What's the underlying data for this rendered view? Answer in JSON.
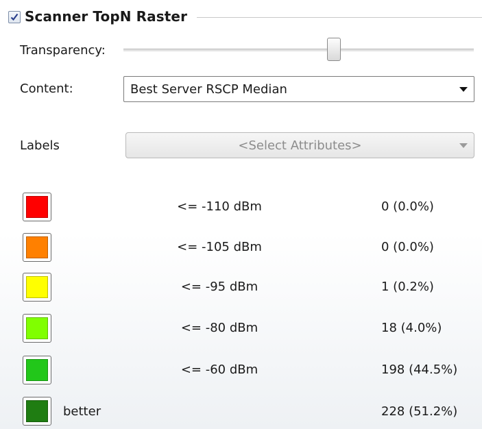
{
  "group": {
    "title": "Scanner TopN Raster",
    "enabled": true
  },
  "transparency": {
    "label": "Transparency:",
    "value": 0.6
  },
  "content": {
    "label": "Content:",
    "value": "Best Server RSCP Median"
  },
  "labels": {
    "label": "Labels",
    "placeholder": "<Select Attributes>",
    "enabled": false
  },
  "legend": [
    {
      "color": "#ff0000",
      "threshold": "<= -110 dBm",
      "count": "0 (0.0%)"
    },
    {
      "color": "#ff8000",
      "threshold": "<= -105 dBm",
      "count": "0 (0.0%)"
    },
    {
      "color": "#ffff00",
      "threshold": "<= -95 dBm",
      "count": "1 (0.2%)"
    },
    {
      "color": "#80ff00",
      "threshold": "<= -80 dBm",
      "count": "18 (4.0%)"
    },
    {
      "color": "#22c71a",
      "threshold": "<= -60 dBm",
      "count": "198 (44.5%)"
    },
    {
      "color": "#1f7d12",
      "threshold": "better",
      "count": "228 (51.2%)"
    }
  ]
}
